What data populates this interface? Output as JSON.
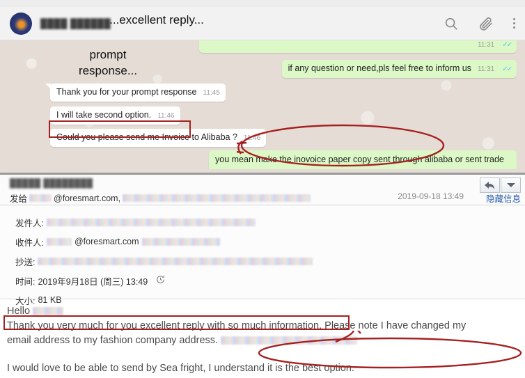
{
  "whatsapp": {
    "contact_name": "████ ██████",
    "icons": {
      "search": "search-icon",
      "attach": "paperclip-icon",
      "menu": "vertical-dots-icon"
    },
    "messages": [
      {
        "direction": "out",
        "text": "",
        "time": "11:31",
        "ticks": "✓✓"
      },
      {
        "direction": "out",
        "text": "if any question or need,pls feel free to inform us",
        "time": "11:31",
        "ticks": "✓✓"
      },
      {
        "direction": "in",
        "text": "Thank you for your prompt response",
        "time": "11:45",
        "ticks": ""
      },
      {
        "direction": "in",
        "text": "I will take second option.",
        "time": "11:46",
        "ticks": ""
      },
      {
        "direction": "in",
        "text": "Could you please send me Invoice to Alibaba ?",
        "time": "11:46",
        "ticks": ""
      },
      {
        "direction": "out",
        "text": "you mean make the inovoice paper copy sent through alibaba or sent trade",
        "time": "",
        "ticks": ""
      }
    ],
    "annotation": {
      "line1": "prompt",
      "line2": "response..."
    }
  },
  "email": {
    "sender_name": "█████ ████████",
    "to_label": "发给",
    "to_address": "@foresmart.com,",
    "date": "2019-09-18 13:49",
    "hide_link": "隐藏信息",
    "details": [
      {
        "label": "发件人:",
        "value": ""
      },
      {
        "label": "收件人:",
        "value": "@foresmart.com"
      },
      {
        "label": "抄送:",
        "value": ""
      },
      {
        "label": "时间:",
        "value": "2019年9月18日 (周三) 13:49"
      },
      {
        "label": "大小:",
        "value": "81 KB"
      }
    ],
    "buttons": {
      "reply": "reply-arrow-icon",
      "more": "chevron-down-icon"
    },
    "body": {
      "greeting": "Hello",
      "line1_highlight": "Thank you very much for you excellent reply with so much information.",
      "line1_rest": "Please note I have changed my",
      "line2": "email address to my fashion company address.",
      "line3": "I would love to be able to send by Sea fright, I understand it is the best option."
    },
    "annotation": "...excellent reply..."
  },
  "colors": {
    "outgoing_bubble": "#dcf8c6",
    "incoming_bubble": "#ffffff",
    "chat_background": "#e5ddd5",
    "annotation_red": "#a52121",
    "link_blue": "#2b5faa"
  }
}
